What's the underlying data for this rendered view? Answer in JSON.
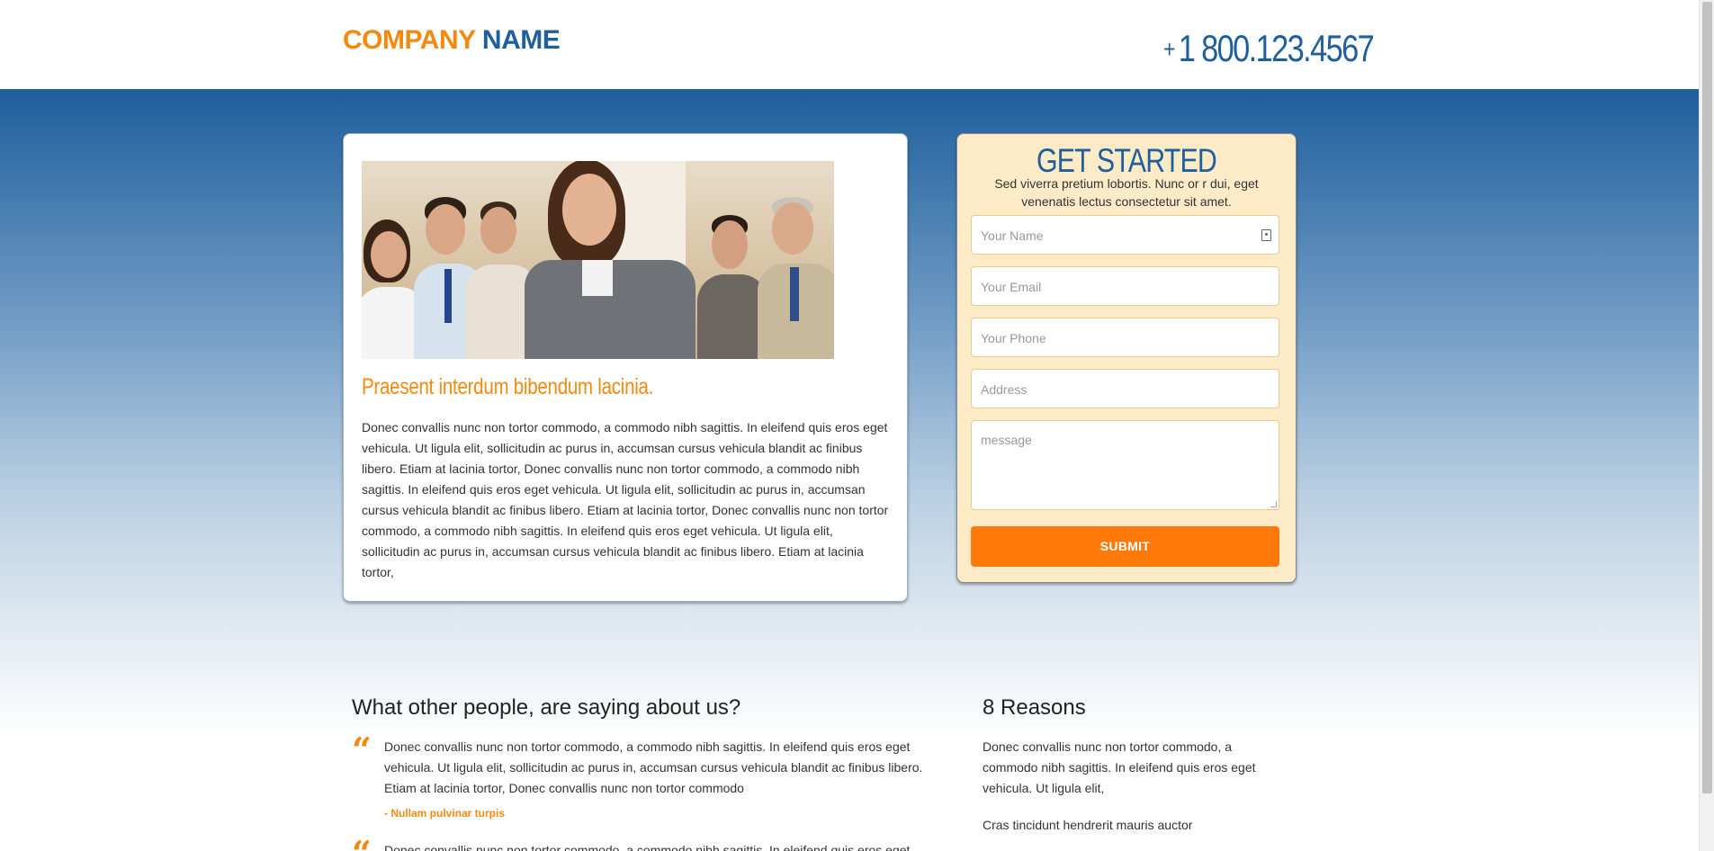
{
  "header": {
    "logo_part1": "COMPANY",
    "logo_part2": "NAME",
    "phone_plus": "+",
    "phone_number": "1 800.123.4567"
  },
  "hero_card": {
    "heading": "Praesent interdum bibendum lacinia.",
    "body": "Donec convallis nunc non tortor commodo, a commodo nibh sagittis. In eleifend quis eros eget vehicula. Ut ligula elit, sollicitudin ac purus in, accumsan cursus vehicula blandit ac finibus libero. Etiam at lacinia tortor, Donec convallis nunc non tortor commodo, a commodo nibh sagittis. In eleifend quis eros eget vehicula. Ut ligula elit, sollicitudin ac purus in, accumsan cursus vehicula blandit ac finibus libero. Etiam at lacinia tortor, Donec convallis nunc non tortor commodo, a commodo nibh sagittis. In eleifend quis eros eget vehicula. Ut ligula elit, sollicitudin ac purus in, accumsan cursus vehicula blandit ac finibus libero. Etiam at lacinia tortor,"
  },
  "form": {
    "title": "GET STARTED",
    "subtitle": "Sed viverra pretium lobortis. Nunc or r dui, eget venenatis lectus consectetur sit amet.",
    "name_placeholder": "Your Name",
    "email_placeholder": "Your Email",
    "phone_placeholder": "Your Phone",
    "address_placeholder": "Address",
    "message_placeholder": "message",
    "submit_label": "SUBMIT"
  },
  "testimonials": {
    "title": "What other people, are saying about us?",
    "items": [
      {
        "text": "Donec convallis nunc non tortor commodo, a commodo nibh sagittis. In eleifend quis eros eget vehicula. Ut ligula elit, sollicitudin ac purus in, accumsan cursus vehicula blandit ac finibus libero. Etiam at lacinia tortor, Donec convallis nunc non tortor commodo",
        "author": "- Nullam pulvinar turpis"
      },
      {
        "text": "Donec convallis nunc non tortor commodo, a commodo nibh sagittis. In eleifend quis eros eget"
      }
    ]
  },
  "reasons": {
    "title": "8 Reasons",
    "body": "Donec convallis nunc non tortor commodo, a commodo nibh sagittis. In eleifend quis eros eget vehicula. Ut ligula elit,",
    "item": "Cras tincidunt hendrerit mauris auctor"
  },
  "colors": {
    "brand_orange": "#f28a0f",
    "brand_blue": "#1f5f9c",
    "submit_orange": "#ff7a0a",
    "form_bg": "#fdebc7"
  }
}
